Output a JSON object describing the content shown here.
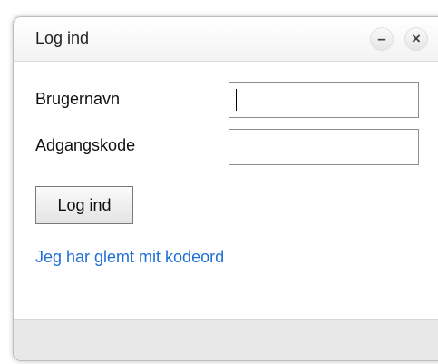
{
  "dialog": {
    "title": "Log ind",
    "minimize_label": "–",
    "close_label": "×"
  },
  "form": {
    "username_label": "Brugernavn",
    "username_value": "",
    "password_label": "Adgangskode",
    "password_value": "",
    "submit_label": "Log ind",
    "forgot_link": "Jeg har glemt mit kodeord"
  },
  "colors": {
    "link": "#1d6fd6",
    "footer": "#e8e8e8"
  }
}
